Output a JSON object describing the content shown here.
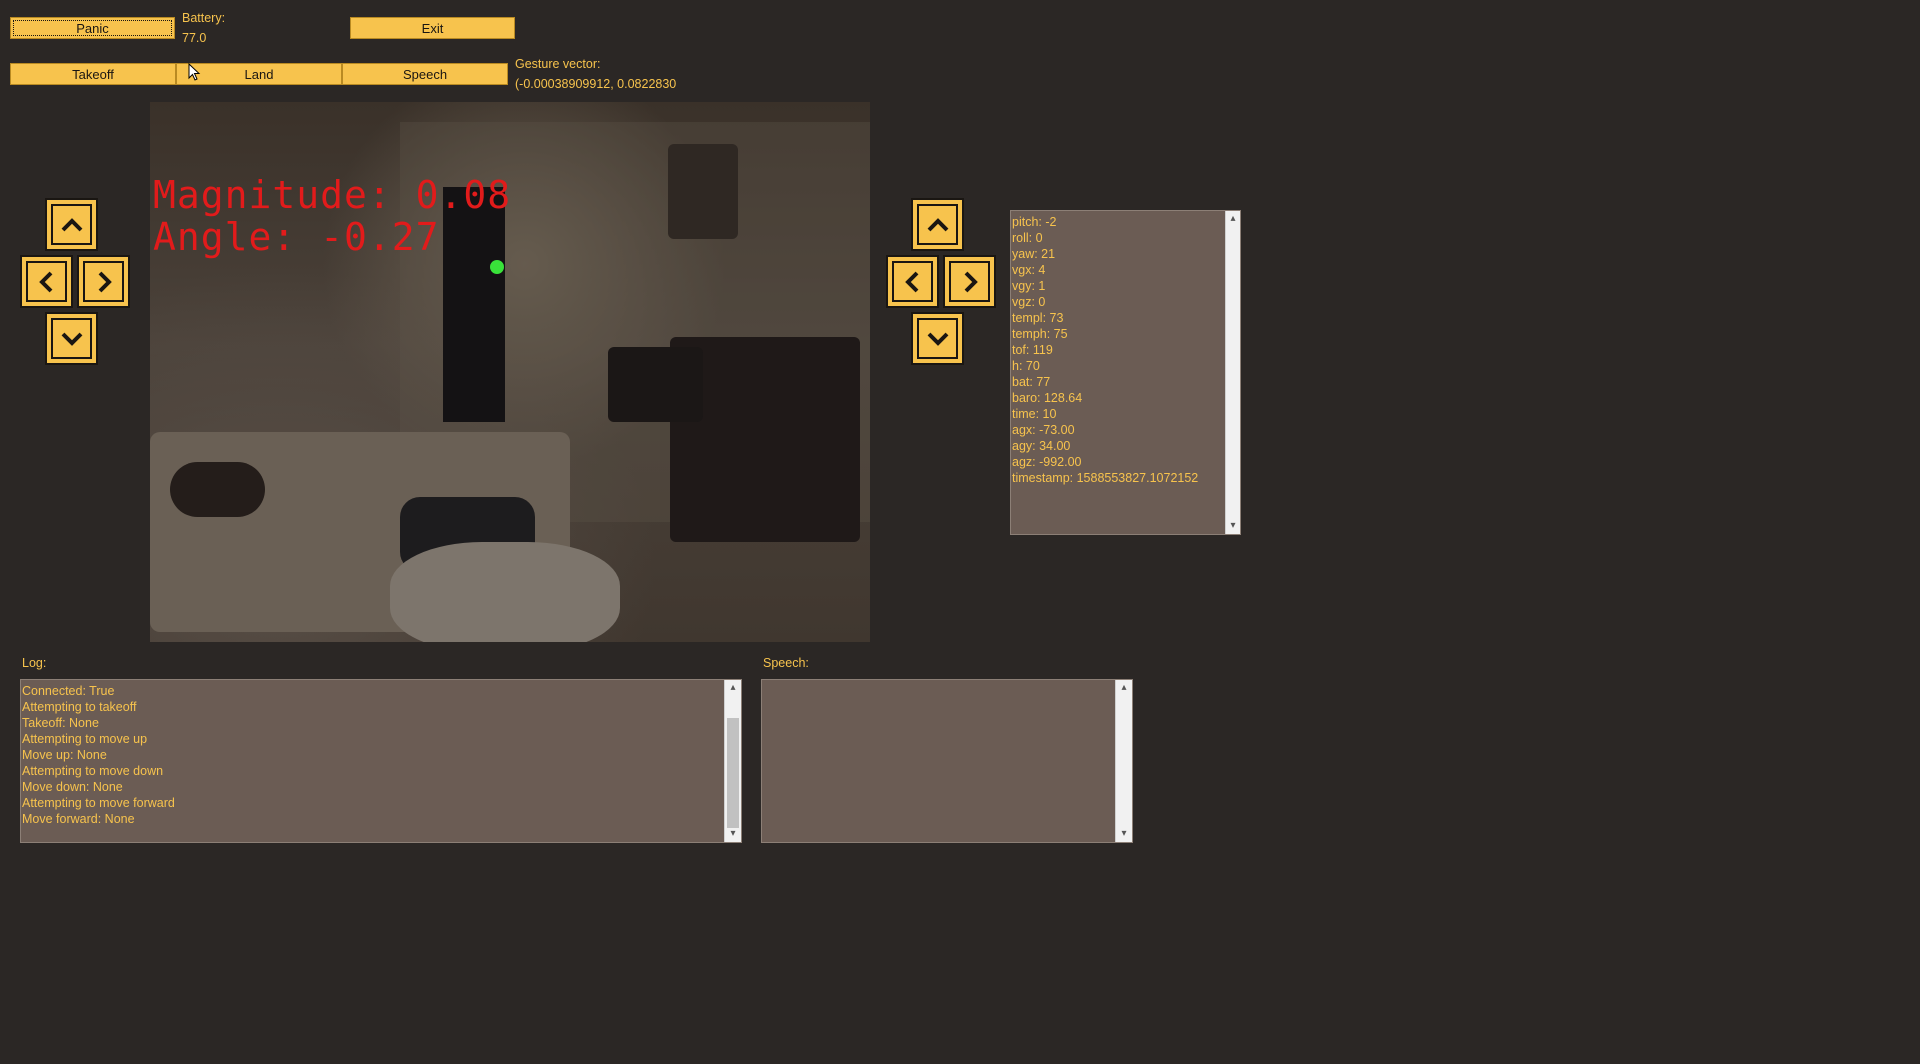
{
  "buttons": {
    "panic": "Panic",
    "exit": "Exit",
    "takeoff": "Takeoff",
    "land": "Land",
    "speech": "Speech"
  },
  "battery": {
    "label": "Battery:",
    "value": "77.0"
  },
  "gesture": {
    "label": "Gesture vector:",
    "value": "(-0.00038909912, 0.0822830"
  },
  "video": {
    "magnitude": "Magnitude: 0.08",
    "angle": "Angle: -0.27"
  },
  "controls": {
    "up_icon": "chevron-up-icon",
    "left_icon": "chevron-left-icon",
    "right_icon": "chevron-right-icon",
    "down_icon": "chevron-down-icon"
  },
  "state_panel": {
    "lines": [
      "pitch: -2",
      "roll: 0",
      "yaw: 21",
      "vgx: 4",
      "vgy: 1",
      "vgz: 0",
      "templ: 73",
      "temph: 75",
      "tof: 119",
      "h: 70",
      "bat: 77",
      "baro: 128.64",
      "time: 10",
      "agx: -73.00",
      "agy: 34.00",
      "agz: -992.00",
      "timestamp: 1588553827.1072152"
    ]
  },
  "log": {
    "label": "Log:",
    "lines": [
      "Connected: True",
      "Attempting to takeoff",
      "Takeoff: None",
      "Attempting to move up",
      "Move up: None",
      "Attempting to move down",
      "Move down: None",
      "Attempting to move forward",
      "Move forward: None"
    ]
  },
  "speech": {
    "label": "Speech:",
    "lines": []
  },
  "colors": {
    "background": "#2b2725",
    "accent": "#f7c34d",
    "panel": "#6b5c54",
    "overlay_text": "#e21b1b",
    "gesture_dot": "#39e23a"
  }
}
